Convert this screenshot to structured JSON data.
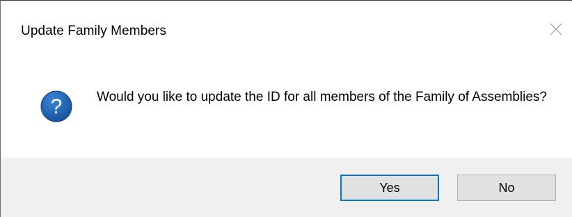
{
  "window": {
    "title": "Update Family Members",
    "close_icon": "close-icon"
  },
  "message": {
    "icon": "question-icon",
    "icon_glyph": "?",
    "icon_color": "#1e5aa8",
    "text": "Would you like to update the ID for all members of the Family of Assemblies?"
  },
  "buttons": {
    "yes_label": "Yes",
    "no_label": "No",
    "default_focus_color": "#0078d7"
  }
}
